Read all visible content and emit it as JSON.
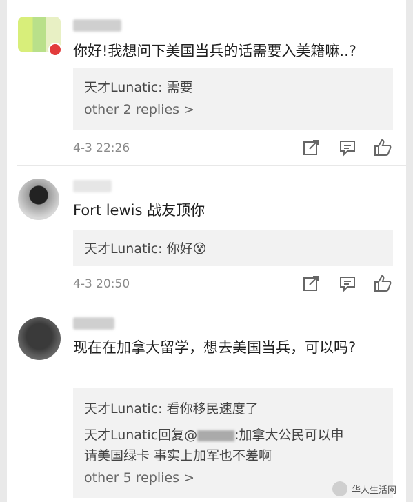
{
  "comments": [
    {
      "text": "你好!我想问下美国当兵的话需要入美籍嘛..?",
      "replies": [
        "天才Lunatic: 需要"
      ],
      "more": "other 2 replies >",
      "time": "4-3 22:26"
    },
    {
      "text": "Fort lewis 战友顶你",
      "replies": [
        "天才Lunatic: 你好😵"
      ],
      "more": "",
      "time": "4-3 20:50"
    },
    {
      "text": "现在在加拿大留学，想去美国当兵，可以吗?",
      "replies": [
        "天才Lunatic: 看你移民速度了",
        "天才Lunatic回复@",
        ":加拿大公民可以申",
        "请美国绿卡 事实上加军也不差啊"
      ],
      "more": "other 5 replies >",
      "time": ""
    }
  ],
  "icons": [
    "share-icon",
    "comment-icon",
    "like-icon"
  ],
  "watermark": "华人生活网"
}
